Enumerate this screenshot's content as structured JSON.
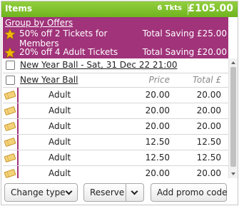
{
  "header": {
    "title": "Items",
    "tickets": "6 Tkts",
    "total": "£105.00"
  },
  "offers": {
    "group_label": "Group by Offers",
    "items": [
      {
        "description": "50% off 2 Tickets for Members",
        "saving": "Total Saving £25.00"
      },
      {
        "description": "20% off 4 Adult Tickets",
        "saving": "Total Saving £20.00"
      }
    ]
  },
  "event_group": {
    "label": "New Year Ball - Sat, 31 Dec 22 21:00"
  },
  "event": {
    "name": "New Year Ball",
    "price_header": "Price",
    "total_header": "Total £"
  },
  "tickets": [
    {
      "type": "Adult",
      "price": "20.00",
      "total": "20.00"
    },
    {
      "type": "Adult",
      "price": "20.00",
      "total": "20.00"
    },
    {
      "type": "Adult",
      "price": "20.00",
      "total": "20.00"
    },
    {
      "type": "Adult",
      "price": "12.50",
      "total": "12.50"
    },
    {
      "type": "Adult",
      "price": "12.50",
      "total": "12.50"
    },
    {
      "type": "Adult",
      "price": "20.00",
      "total": "20.00"
    }
  ],
  "footer": {
    "change_type": "Change type",
    "reserve": "Reserve",
    "add_promo": "Add promo code"
  },
  "colors": {
    "header_green": "#7cc12a",
    "offer_purple": "#a0337a",
    "star": "#f2b705",
    "ticket_icon": "#e3b33a"
  },
  "icons": {
    "star": "star-icon",
    "ticket": "ticket-icon",
    "chevron": "chevron-down-icon"
  }
}
